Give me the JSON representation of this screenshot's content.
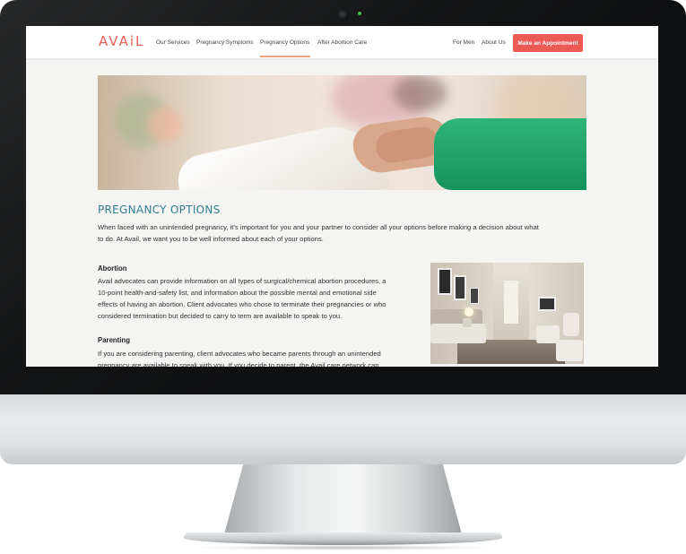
{
  "site": {
    "logo": "AVAiL",
    "nav": [
      {
        "label": "Our Services"
      },
      {
        "label": "Pregnancy Symptoms"
      },
      {
        "label": "Pregnancy Options"
      },
      {
        "label": "After Abortion Care"
      }
    ],
    "nav_right": [
      {
        "label": "For Men"
      },
      {
        "label": "About Us"
      }
    ],
    "cta": "Make an Appointment"
  },
  "content": {
    "title": "PREGNANCY OPTIONS",
    "intro": [
      "When faced with an unintended pregnancy, it's important for you and your partner to consider all your options before making a decision about what",
      "to do. At Avail, we want you to be well informed about each of your options."
    ],
    "sections": [
      {
        "heading": "Abortion",
        "lines": [
          "Avail advocates can provide information on all types of surgical/chemical abortion procedures, a",
          "10-point health-and-safety list, and information about the possible mental and emotional side",
          "effects of having an abortion. Client advocates who chose to terminate their pregnancies or who",
          "considered termination but decided to carry to term are available to speak to you."
        ]
      },
      {
        "heading": "Parenting",
        "lines": [
          "If you are considering parenting, client advocates who became parents through an unintended",
          "pregnancy are available to speak with you. If you decide to parent, the Avail care network can"
        ]
      }
    ]
  },
  "colors": {
    "brand": "#e8625a",
    "cta": "#ec5a55",
    "heading": "#2f7f8f",
    "active_underline": "#f2a27f"
  }
}
